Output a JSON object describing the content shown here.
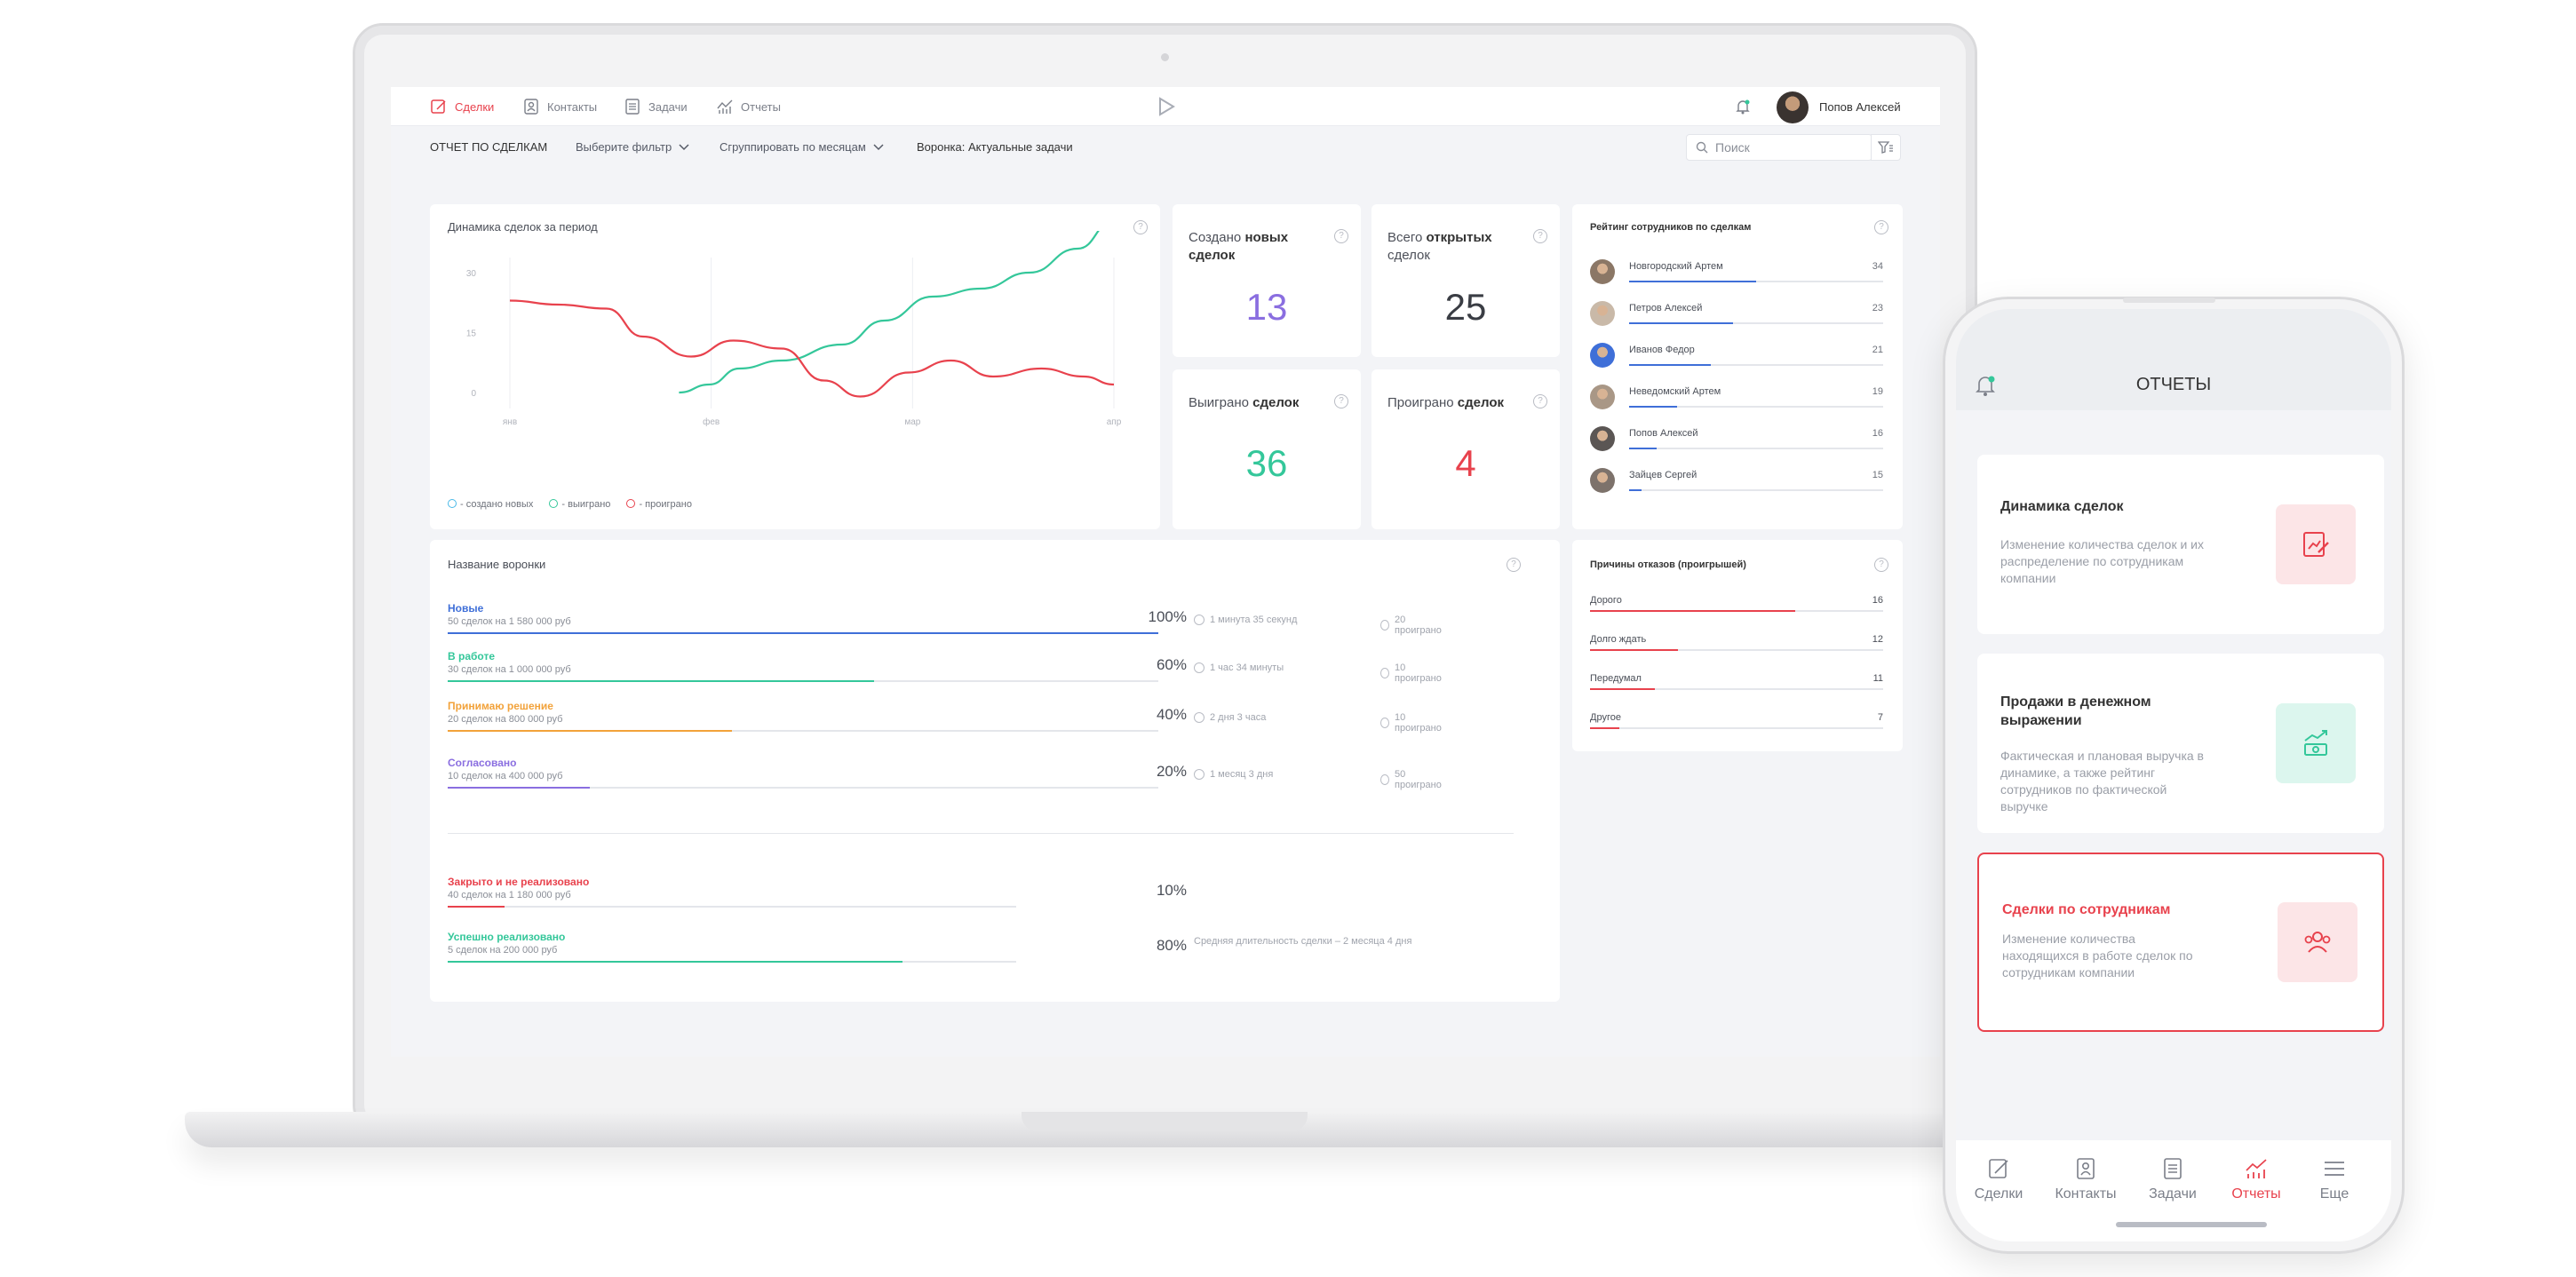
{
  "nav": {
    "items": [
      {
        "label": "Сделки",
        "icon": "deals-icon",
        "active": true
      },
      {
        "label": "Контакты",
        "icon": "contacts-icon",
        "active": false
      },
      {
        "label": "Задачи",
        "icon": "tasks-icon",
        "active": false
      },
      {
        "label": "Отчеты",
        "icon": "reports-icon",
        "active": false
      }
    ],
    "user_name": "Попов Алексей"
  },
  "subbar": {
    "report_title": "ОТЧЕТ ПО СДЕЛКАМ",
    "filter_label": "Выберите фильтр",
    "group_label": "Сгруппировать по месяцам",
    "funnel_label": "Воронка: Актуальные задачи",
    "search_placeholder": "Поиск"
  },
  "dynamics": {
    "title": "Динамика сделок за период",
    "legend": [
      "- создано новых",
      "- выиграно",
      "- проиграно"
    ]
  },
  "chart_data": {
    "type": "line",
    "x": [
      "янв",
      "фев",
      "мар",
      "апр"
    ],
    "ylim": [
      0,
      30
    ],
    "yticks": [
      "30",
      "15",
      "0"
    ],
    "series": [
      {
        "name": "- выиграно",
        "color": "#34c79a",
        "points": [
          [
            0.28,
            0
          ],
          [
            0.33,
            2
          ],
          [
            0.38,
            6
          ],
          [
            0.45,
            8
          ],
          [
            0.55,
            12
          ],
          [
            0.62,
            18
          ],
          [
            0.7,
            24
          ],
          [
            0.78,
            26
          ],
          [
            0.86,
            30
          ],
          [
            0.94,
            36
          ],
          [
            1.0,
            43
          ]
        ]
      },
      {
        "name": "- проиграно",
        "color": "#e8424d",
        "points": [
          [
            0.0,
            23
          ],
          [
            0.08,
            22
          ],
          [
            0.16,
            21
          ],
          [
            0.22,
            14
          ],
          [
            0.3,
            9
          ],
          [
            0.37,
            13
          ],
          [
            0.45,
            11
          ],
          [
            0.52,
            3
          ],
          [
            0.58,
            -1
          ],
          [
            0.66,
            5
          ],
          [
            0.73,
            8
          ],
          [
            0.8,
            4
          ],
          [
            0.88,
            6
          ],
          [
            0.95,
            4
          ],
          [
            1.0,
            2
          ]
        ]
      }
    ]
  },
  "stats": {
    "created": {
      "pre": "Создано ",
      "bold": "новых сделок",
      "value": "13",
      "color": "#8a6ee0"
    },
    "open": {
      "pre": "Всего ",
      "bold": "открытых",
      "post": " сделок",
      "value": "25",
      "color": "#3a3d44"
    },
    "won": {
      "pre": "Выиграно ",
      "bold": "сделок",
      "value": "36",
      "color": "#34c79a"
    },
    "lost": {
      "pre": "Проиграно ",
      "bold": "сделок",
      "value": "4",
      "color": "#e8424d"
    }
  },
  "rating": {
    "title": "Рейтинг сотрудников по сделкам",
    "rows": [
      {
        "name": "Новгородский Артем",
        "value": "34",
        "fraction": 0.5
      },
      {
        "name": "Петров Алексей",
        "value": "23",
        "fraction": 0.41
      },
      {
        "name": "Иванов Федор",
        "value": "21",
        "fraction": 0.32
      },
      {
        "name": "Неведомский Артем",
        "value": "19",
        "fraction": 0.19
      },
      {
        "name": "Попов Алексей",
        "value": "16",
        "fraction": 0.11
      },
      {
        "name": "Зайцев Сергей",
        "value": "15",
        "fraction": 0.05
      }
    ]
  },
  "funnel": {
    "title": "Название воронки",
    "rows": [
      {
        "name": "Новые",
        "sub": "50 сделок на 1 580 000 руб",
        "pct": "100%",
        "fraction": 1.0,
        "color": "#3f6fd8",
        "duration": "1 минута 35 секунд",
        "lost": "20 проиграно"
      },
      {
        "name": "В работе",
        "sub": "30 сделок на 1 000 000 руб",
        "pct": "60%",
        "fraction": 0.6,
        "color": "#34c79a",
        "duration": "1 час 34 минуты",
        "lost": "10 проиграно"
      },
      {
        "name": "Принимаю решение",
        "sub": "20 сделок на 800 000 руб",
        "pct": "40%",
        "fraction": 0.4,
        "color": "#f2a23a",
        "duration": "2 дня 3 часа",
        "lost": "10 проиграно"
      },
      {
        "name": "Согласовано",
        "sub": "10 сделок на 400 000 руб",
        "pct": "20%",
        "fraction": 0.2,
        "color": "#8a6ee0",
        "duration": "1 месяц 3 дня",
        "lost": "50 проиграно"
      }
    ],
    "closed": [
      {
        "name": "Закрыто и не реализовано",
        "sub": "40 сделок на 1 180 000 руб",
        "pct": "10%",
        "fraction": 0.1,
        "color": "#e8424d"
      },
      {
        "name": "Успешно реализовано",
        "sub": "5 сделок на 200 000 руб",
        "pct": "80%",
        "fraction": 0.8,
        "color": "#34c79a"
      }
    ],
    "avg_duration": "Средняя длительность сделки – 2 месяца 4 дня"
  },
  "reasons": {
    "title": "Причины отказов (проигрышей)",
    "rows": [
      {
        "name": "Дорого",
        "value": "16",
        "fraction": 0.7
      },
      {
        "name": "Долго ждать",
        "value": "12",
        "fraction": 0.3
      },
      {
        "name": "Передумал",
        "value": "11",
        "fraction": 0.22
      },
      {
        "name": "Другое",
        "value": "7",
        "fraction": 0.1
      }
    ]
  },
  "phone": {
    "title": "ОТЧЕТЫ",
    "cards": [
      {
        "title": "Динамика сделок",
        "desc": "Изменение количества сделок и их распределение по сотрудникам компании",
        "icon": "chart-pen-icon",
        "active": false
      },
      {
        "title": "Продажи в денежном выражении",
        "desc": "Фактическая и плановая выручка в динамике, а также рейтинг сотрудников по фактической выручке",
        "icon": "money-chart-icon",
        "active": false
      },
      {
        "title": "Сделки по сотрудникам",
        "desc": "Изменение количества находящихся в работе сделок по сотрудникам компании",
        "icon": "people-icon",
        "active": true
      }
    ],
    "tabs": [
      {
        "label": "Сделки",
        "icon": "deals-icon"
      },
      {
        "label": "Контакты",
        "icon": "contacts-icon"
      },
      {
        "label": "Задачи",
        "icon": "tasks-icon"
      },
      {
        "label": "Отчеты",
        "icon": "reports-icon",
        "active": true
      },
      {
        "label": "Еще",
        "icon": "menu-icon"
      }
    ]
  },
  "colors": {
    "accent": "#e8424d",
    "green": "#34c79a",
    "blue": "#3f6fd8",
    "purple": "#8a6ee0",
    "orange": "#f2a23a"
  }
}
